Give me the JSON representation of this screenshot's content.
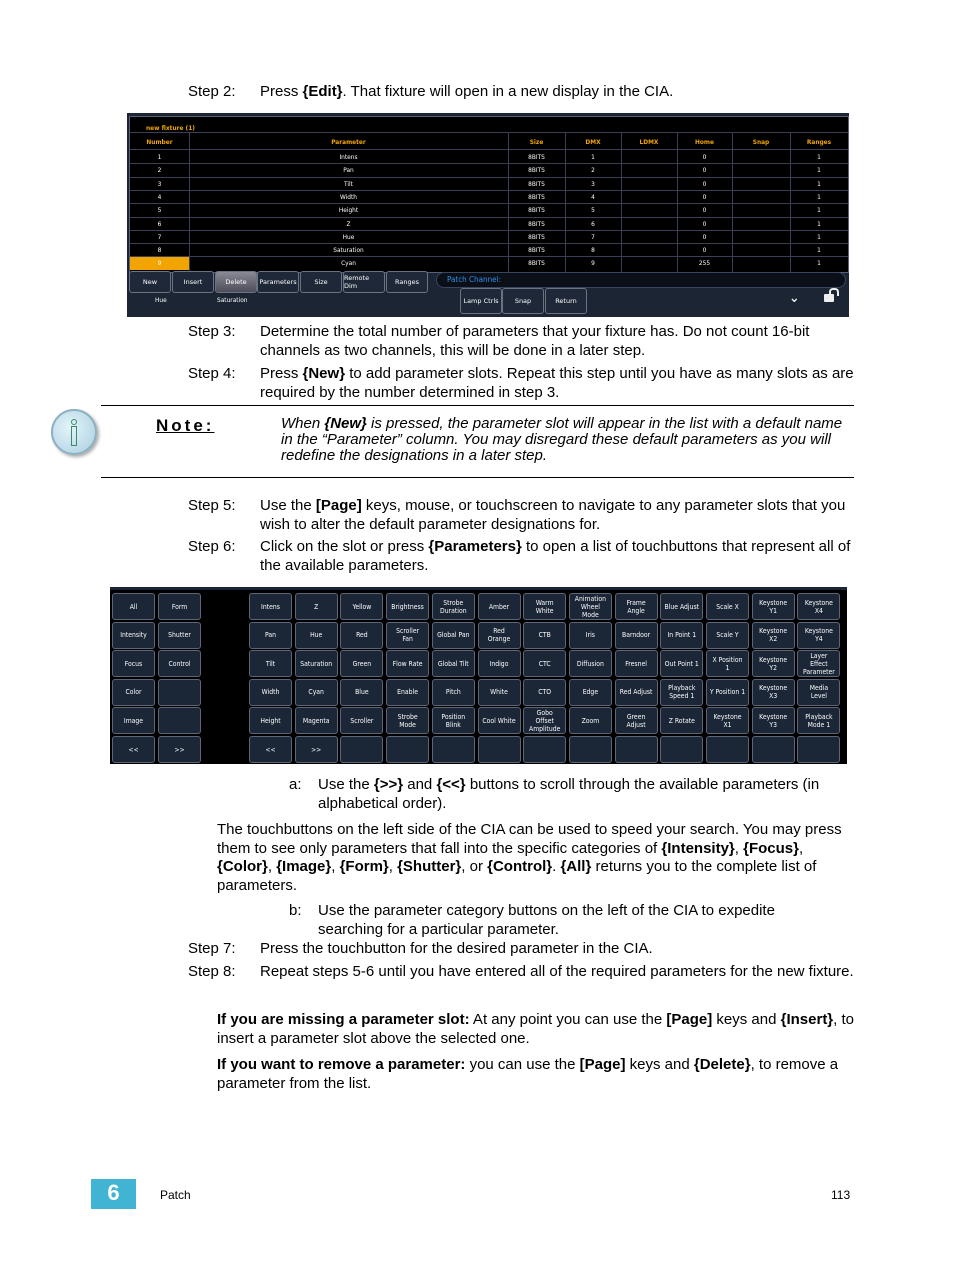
{
  "steps": {
    "s2": {
      "label": "Step 2:",
      "text": [
        {
          "t": "Press "
        },
        {
          "t": "{Edit}",
          "b": true
        },
        {
          "t": ". That fixture will open in a new display in the CIA."
        }
      ]
    },
    "s3": {
      "label": "Step 3:",
      "text": [
        {
          "t": "Determine the total number of parameters that your fixture has. Do not count 16-bit channels as two channels, this will be done in a later step."
        }
      ]
    },
    "s4": {
      "label": "Step 4:",
      "text": [
        {
          "t": "Press "
        },
        {
          "t": "{New}",
          "b": true
        },
        {
          "t": " to add parameter slots. Repeat this step until you have as many slots as are required by the number determined in step 3."
        }
      ]
    },
    "s5": {
      "label": "Step 5:",
      "text": [
        {
          "t": "Use the "
        },
        {
          "t": "[Page]",
          "b": true
        },
        {
          "t": " keys, mouse, or touchscreen to navigate to any parameter slots that you wish to alter the default parameter designations for."
        }
      ]
    },
    "s6": {
      "label": "Step 6:",
      "text": [
        {
          "t": "Click on the slot or press "
        },
        {
          "t": "{Parameters}",
          "b": true
        },
        {
          "t": " to open a list of touchbuttons that represent all of the available parameters."
        }
      ]
    },
    "sa": {
      "label": "a:",
      "text": [
        {
          "t": "Use the "
        },
        {
          "t": "{>>}",
          "b": true
        },
        {
          "t": " and "
        },
        {
          "t": "{<<}",
          "b": true
        },
        {
          "t": " buttons to scroll through the available parameters (in alphabetical order)."
        }
      ]
    },
    "p1": {
      "text": [
        {
          "t": "The touchbuttons on the left side of the CIA can be used to speed your search. You may press them to see only parameters that fall into the specific categories of "
        },
        {
          "t": "{Intensity}",
          "b": true
        },
        {
          "t": ", "
        },
        {
          "t": "{Focus}",
          "b": true
        },
        {
          "t": ", "
        },
        {
          "t": "{Color}",
          "b": true
        },
        {
          "t": ", "
        },
        {
          "t": "{Image}",
          "b": true
        },
        {
          "t": ", "
        },
        {
          "t": "{Form}",
          "b": true
        },
        {
          "t": ", "
        },
        {
          "t": "{Shutter}",
          "b": true
        },
        {
          "t": ", or "
        },
        {
          "t": "{Control}",
          "b": true
        },
        {
          "t": ". "
        },
        {
          "t": "{All}",
          "b": true
        },
        {
          "t": " returns you to the complete list of parameters."
        }
      ]
    },
    "sb": {
      "label": "b:",
      "text": [
        {
          "t": "Use the parameter category buttons on the left of the CIA to expedite searching for a particular parameter."
        }
      ]
    },
    "s7": {
      "label": "Step 7:",
      "text": [
        {
          "t": "Press the touchbutton for the desired parameter in the CIA."
        }
      ]
    },
    "s8": {
      "label": "Step 8:",
      "text": [
        {
          "t": "Repeat steps 5-6 until you have entered all of the required parameters for the new fixture."
        }
      ]
    },
    "p2": {
      "text": [
        {
          "t": "If you are missing a parameter slot:",
          "b": true
        },
        {
          "t": " At any point you can use the "
        },
        {
          "t": "[Page]",
          "b": true
        },
        {
          "t": " keys and "
        },
        {
          "t": "{Insert}",
          "b": true
        },
        {
          "t": ", to insert a parameter slot above the selected one."
        }
      ]
    },
    "p3": {
      "text": [
        {
          "t": "If you want to remove a parameter:",
          "b": true
        },
        {
          "t": " you can use the "
        },
        {
          "t": "[Page]",
          "b": true
        },
        {
          "t": " keys and "
        },
        {
          "t": "{Delete}",
          "b": true
        },
        {
          "t": ", to remove a parameter from the list."
        }
      ]
    }
  },
  "note": {
    "label": "Note:",
    "icon": "info-icon",
    "text": [
      {
        "t": "When "
      },
      {
        "t": "{New}",
        "b": true
      },
      {
        "t": " is pressed, the parameter slot will appear in the list with a default name in the “Parameter” column. You may disregard these default parameters as you will redefine the designations in a later step."
      }
    ]
  },
  "cia1": {
    "title": "new fixture (1)",
    "columns": [
      "Number",
      "Parameter",
      "Size",
      "DMX",
      "LDMX",
      "Home",
      "Snap",
      "Ranges"
    ],
    "rows": [
      [
        "1",
        "Intens",
        "8BITS",
        "1",
        "",
        "0",
        "",
        "1"
      ],
      [
        "2",
        "Pan",
        "8BITS",
        "2",
        "",
        "0",
        "",
        "1"
      ],
      [
        "3",
        "Tilt",
        "8BITS",
        "3",
        "",
        "0",
        "",
        "1"
      ],
      [
        "4",
        "Width",
        "8BITS",
        "4",
        "",
        "0",
        "",
        "1"
      ],
      [
        "5",
        "Height",
        "8BITS",
        "5",
        "",
        "0",
        "",
        "1"
      ],
      [
        "6",
        "Z",
        "8BITS",
        "6",
        "",
        "0",
        "",
        "1"
      ],
      [
        "7",
        "Hue",
        "8BITS",
        "7",
        "",
        "0",
        "",
        "1"
      ],
      [
        "8",
        "Saturation",
        "8BITS",
        "8",
        "",
        "0",
        "",
        "1"
      ],
      [
        "9",
        "Cyan",
        "8BITS",
        "9",
        "",
        "255",
        "",
        "1"
      ]
    ],
    "selected_row": 8,
    "accent": "#f2a500",
    "buttons": [
      "New",
      "Insert",
      "Delete",
      "Parameters",
      "Size",
      "Remote Dim",
      "Ranges"
    ],
    "selected_button": "Delete",
    "patch_channel_label": "Patch Channel:",
    "sub_labels": [
      "Hue",
      "Saturation"
    ],
    "lower_buttons": [
      "Lamp Ctrls",
      "Snap",
      "Return"
    ],
    "icons": [
      "double-chevron-down-icon",
      "unlock-icon"
    ]
  },
  "cia2": {
    "categories": [
      [
        "All",
        "Form"
      ],
      [
        "Intensity",
        "Shutter"
      ],
      [
        "Focus",
        "Control"
      ],
      [
        "Color",
        ""
      ],
      [
        "Image",
        ""
      ],
      [
        "<<",
        ">>"
      ]
    ],
    "params": [
      [
        "Intens",
        "Z",
        "Yellow",
        "Brightness",
        "Strobe\nDuration",
        "Amber",
        "Warm\nWhite",
        "Animation\nWheel\nMode",
        "Frame\nAngle",
        "Blue Adjust",
        "Scale X",
        "Keystone\nY1",
        "Keystone\nX4"
      ],
      [
        "Pan",
        "Hue",
        "Red",
        "Scroller\nFan",
        "Global Pan",
        "Red\nOrange",
        "CTB",
        "Iris",
        "Barndoor",
        "In Point 1",
        "Scale Y",
        "Keystone\nX2",
        "Keystone\nY4"
      ],
      [
        "Tilt",
        "Saturation",
        "Green",
        "Flow Rate",
        "Global Tilt",
        "Indigo",
        "CTC",
        "Diffusion",
        "Fresnel",
        "Out Point 1",
        "X Position\n1",
        "Keystone\nY2",
        "Layer\nEffect\nParameter"
      ],
      [
        "Width",
        "Cyan",
        "Blue",
        "Enable",
        "Pitch",
        "White",
        "CTO",
        "Edge",
        "Red Adjust",
        "Playback\nSpeed 1",
        "Y Position 1",
        "Keystone\nX3",
        "Media\nLevel"
      ],
      [
        "Height",
        "Magenta",
        "Scroller",
        "Strobe\nMode",
        "Position\nBlink",
        "Cool White",
        "Gobo\nOffset\nAmplitude",
        "Zoom",
        "Green\nAdjust",
        "Z Rotate",
        "Keystone\nX1",
        "Keystone\nY3",
        "Playback\nMode 1"
      ],
      [
        "<<",
        ">>",
        "",
        "",
        "",
        "",
        "",
        "",
        "",
        "",
        "",
        "",
        ""
      ]
    ]
  },
  "footer": {
    "chapter": "6",
    "section": "Patch",
    "page": "113",
    "chapter_color": "#41b4d3"
  }
}
